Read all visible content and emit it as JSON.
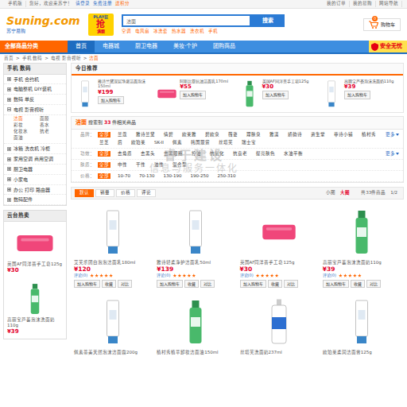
{
  "topbar": {
    "mobile": "手机版",
    "greeting": "您好，欢迎来苏宁！",
    "login": "请登录",
    "register": "免费注册",
    "bonus": "送积分",
    "links": [
      "我的订单",
      "我的易购",
      "网站导航"
    ]
  },
  "logo": {
    "brand": "Suning.com",
    "sub": "苏宁易购"
  },
  "promo": {
    "top": "PLAY狂",
    "main": "抢",
    "bottom": "满额"
  },
  "search": {
    "placeholder": "洁面",
    "button": "搜索",
    "hot": [
      "空调",
      "电风扇",
      "冰洗套",
      "热水器",
      "洗衣机",
      "手机"
    ]
  },
  "cart": {
    "count": "0",
    "label": "购物车"
  },
  "nav": {
    "all": "全部商品分类",
    "items": [
      {
        "label": "首页",
        "selected": true
      },
      {
        "label": "电器城",
        "selected": false
      },
      {
        "label": "厨卫电器",
        "selected": false
      },
      {
        "label": "美妆·个护",
        "selected": false
      },
      {
        "label": "团购商品",
        "selected": false
      }
    ],
    "safe": "安全无忧"
  },
  "breadcrumb": {
    "items": [
      "首页",
      "手机 数码",
      "电视 影音视听",
      "洁面"
    ],
    "separator": ">"
  },
  "sidebar": {
    "title": "手机 数码",
    "items": [
      {
        "label": "手机 合约机",
        "expanded": false
      },
      {
        "label": "电脑整机 DIY装机",
        "expanded": false
      },
      {
        "label": "数码 单反",
        "expanded": false
      },
      {
        "label": "电视 影音视听",
        "expanded": true,
        "sub": [
          {
            "label": "洁面",
            "selected": true
          },
          {
            "label": "面膜",
            "selected": false
          },
          {
            "label": "彩妆",
            "selected": false
          },
          {
            "label": "香水",
            "selected": false
          },
          {
            "label": "化妆水",
            "selected": false
          },
          {
            "label": "抗老",
            "selected": false
          },
          {
            "label": "面油",
            "selected": false
          }
        ]
      },
      {
        "label": "冰箱 洗衣机 冷柜",
        "expanded": false
      },
      {
        "label": "家用空调 商用空调",
        "expanded": false
      },
      {
        "label": "厨卫电器",
        "expanded": false
      },
      {
        "label": "小家电",
        "expanded": false
      },
      {
        "label": "办公 打印 路由器",
        "expanded": false
      },
      {
        "label": "数码配件",
        "expanded": false
      }
    ]
  },
  "hot": {
    "title": "云台热卖",
    "items": [
      {
        "name": "英国AF同洋菩手工皂125g",
        "price": "¥30",
        "kind": "soap"
      },
      {
        "name": "高丽宝芦荟泡沫洗面奶110g",
        "price": "¥39",
        "kind": "bottle"
      }
    ]
  },
  "today": {
    "title": "今日推荐",
    "items": [
      {
        "name": "雅诗兰黛深层净澈洁面泡沫150ml",
        "price": "¥199",
        "button": "加入购物车",
        "kind": "tube"
      },
      {
        "name": "阿斯比亚抗油洁面乳170ml",
        "price": "¥55",
        "button": "加入购物车",
        "kind": "soap"
      },
      {
        "name": "英国AF同洋菩手工皂125g",
        "price": "¥30",
        "button": "加入购物车",
        "kind": "bottle"
      },
      {
        "name": "高丽宝芦荟泡沫洗面奶110g",
        "price": "¥39",
        "button": "加入购物车",
        "kind": "tube"
      }
    ]
  },
  "filter": {
    "keyword": "洁面",
    "prefix": "搜索到",
    "count": "33",
    "suffix": "件相关商品",
    "rows": [
      {
        "label": "品牌：",
        "more": "更多",
        "options": [
          {
            "label": "全部",
            "selected": true
          },
          {
            "label": "兰蔻",
            "selected": false
          },
          {
            "label": "雅诗兰黛",
            "selected": false
          },
          {
            "label": "倩碧",
            "selected": false
          },
          {
            "label": "欧莱雅",
            "selected": false
          },
          {
            "label": "碧欧泉",
            "selected": false
          },
          {
            "label": "薇姿",
            "selected": false
          },
          {
            "label": "理肤泉",
            "selected": false
          },
          {
            "label": "雅漾",
            "selected": false
          },
          {
            "label": "娇韵诗",
            "selected": false
          },
          {
            "label": "资生堂",
            "selected": false
          },
          {
            "label": "菲诗小铺",
            "selected": false
          },
          {
            "label": "植村秀",
            "selected": false
          },
          {
            "label": "兰芝",
            "selected": false
          },
          {
            "label": "后",
            "selected": false
          },
          {
            "label": "欧珀莱",
            "selected": false
          },
          {
            "label": "SK-II",
            "selected": false
          },
          {
            "label": "佩素",
            "selected": false
          },
          {
            "label": "韩国现货",
            "selected": false
          },
          {
            "label": "丝塔芙",
            "selected": false
          },
          {
            "label": "瑞士宝",
            "selected": false
          }
        ]
      },
      {
        "label": "功效：",
        "more": "更多",
        "options": [
          {
            "label": "全部",
            "selected": true
          },
          {
            "label": "去角质",
            "selected": false
          },
          {
            "label": "去黑头",
            "selected": false
          },
          {
            "label": "去黑眼圈",
            "selected": false
          },
          {
            "label": "控油",
            "selected": false
          },
          {
            "label": "抗氧化",
            "selected": false
          },
          {
            "label": "抗衰老",
            "selected": false
          },
          {
            "label": "提亮肤色",
            "selected": false
          },
          {
            "label": "水油平衡",
            "selected": false
          }
        ]
      },
      {
        "label": "肤质：",
        "options": [
          {
            "label": "全部",
            "selected": true
          },
          {
            "label": "中性",
            "selected": false
          },
          {
            "label": "干性",
            "selected": false
          },
          {
            "label": "油性",
            "selected": false
          },
          {
            "label": "混合型",
            "selected": false
          }
        ]
      },
      {
        "label": "价格：",
        "options": [
          {
            "label": "全部",
            "selected": true
          },
          {
            "label": "10-70",
            "selected": false
          },
          {
            "label": "70-130",
            "selected": false
          },
          {
            "label": "130-190",
            "selected": false
          },
          {
            "label": "190-250",
            "selected": false
          },
          {
            "label": "250-310",
            "selected": false
          }
        ]
      }
    ]
  },
  "sort": {
    "items": [
      {
        "label": "默认",
        "selected": true
      },
      {
        "label": "销量",
        "selected": false
      },
      {
        "label": "价格",
        "selected": false
      },
      {
        "label": "评论",
        "selected": false
      }
    ],
    "views": [
      {
        "label": "小图",
        "selected": false
      },
      {
        "label": "大图",
        "selected": true
      }
    ],
    "total": "共33件商品",
    "page": "1/2"
  },
  "products": [
    {
      "name": "艾芙乐团白泡泡洁面乳180ml",
      "price": "¥120",
      "reviews": "评论(0)",
      "stars": 5,
      "buttons": [
        "加入购物车",
        "收藏",
        "对比"
      ],
      "kind": "tube"
    },
    {
      "name": "雅诗轻柔净护洁面乳50ml",
      "price": "¥139",
      "reviews": "评论(0)",
      "stars": 5,
      "buttons": [
        "加入购物车",
        "收藏",
        "对比"
      ],
      "kind": "tube"
    },
    {
      "name": "英国AF同洋菩手工皂125g",
      "price": "¥30",
      "reviews": "评论(0)",
      "stars": 5,
      "buttons": [
        "加入购物车",
        "收藏",
        "对比"
      ],
      "kind": "soap"
    },
    {
      "name": "高丽宝芦荟泡沫洗面奶110g",
      "price": "¥39",
      "reviews": "评论(0)",
      "stars": 5,
      "buttons": [
        "加入购物车",
        "收藏",
        "对比"
      ],
      "kind": "bottle"
    },
    {
      "name": "佩素蒂美天然泡沫洁面霜200g",
      "kind": "tube"
    },
    {
      "name": "植村秀植萃卸妆洁面油150ml",
      "kind": "bottle"
    },
    {
      "name": "丝塔芙洗面奶237ml",
      "kind": "pump"
    },
    {
      "name": "欧珀莱柔润洁面膏125g",
      "kind": "tube"
    }
  ],
  "watermark": {
    "line1": "睿于建设",
    "line2": "信息与服务一体化"
  }
}
